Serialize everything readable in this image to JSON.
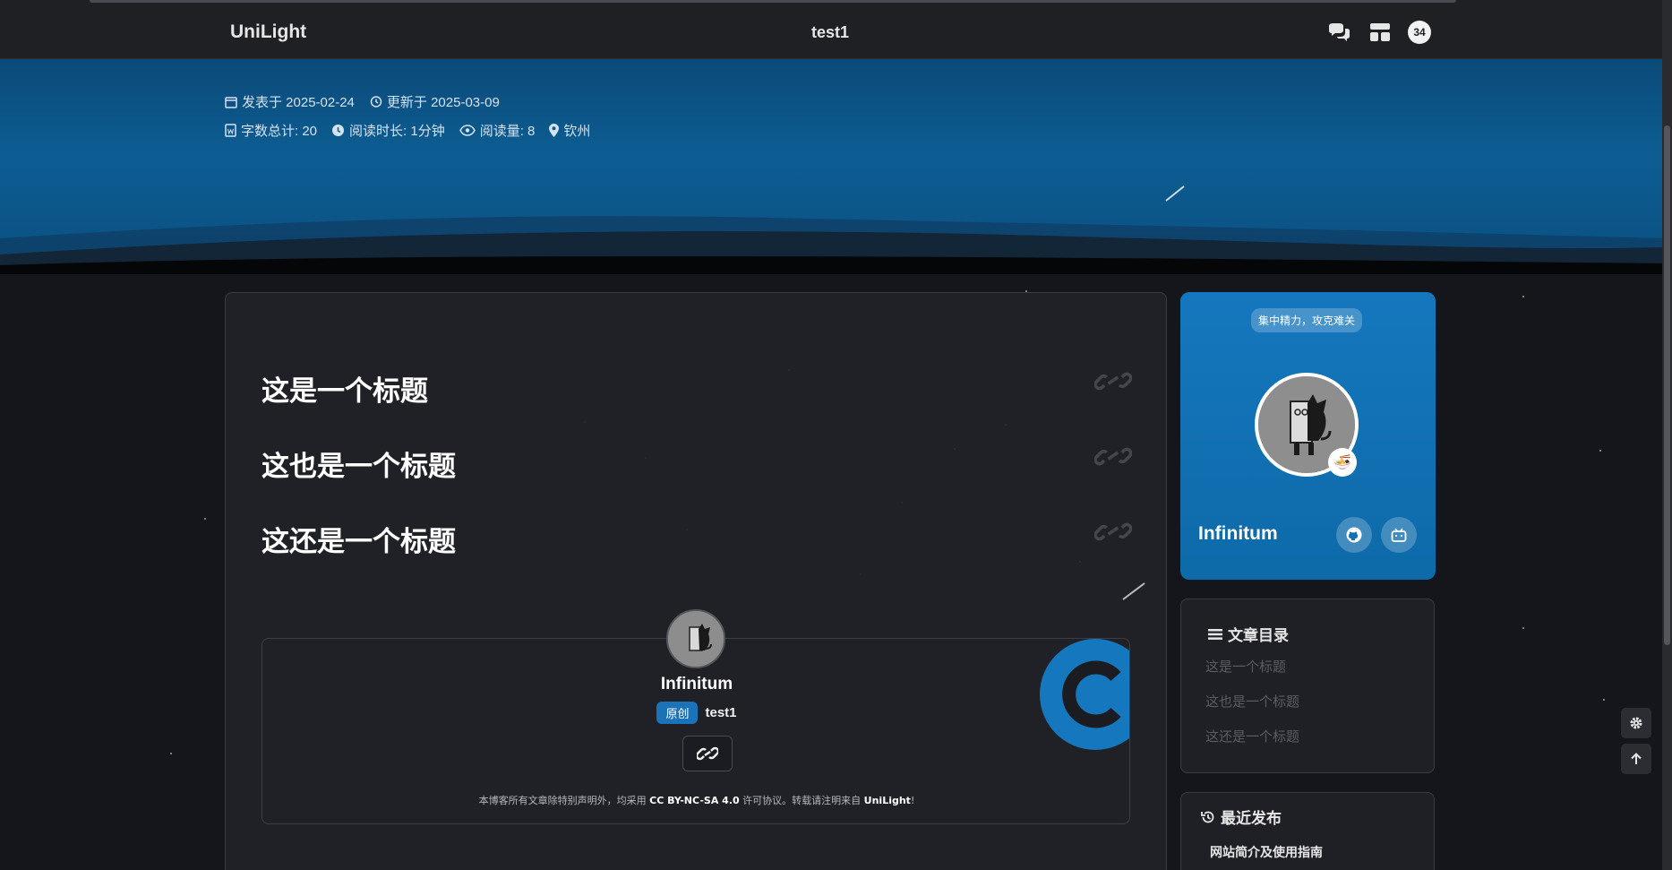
{
  "header": {
    "brand": "UniLight",
    "page_title": "test1",
    "notification_count": "34"
  },
  "meta": {
    "published": "发表于 2025-02-24",
    "updated": "更新于 2025-03-09",
    "word_count": "字数总计: 20",
    "read_time": "阅读时长: 1分钟",
    "views": "阅读量: 8",
    "location": "钦州"
  },
  "article": {
    "headings": [
      "这是一个标题",
      "这也是一个标题",
      "这还是一个标题"
    ]
  },
  "copyright": {
    "author": "Infinitum",
    "tag": "原创",
    "post_title": "test1",
    "license_prefix": "本博客所有文章除特别声明外，均采用 ",
    "license_name": "CC BY-NC-SA 4.0",
    "license_mid": " 许可协议。转载请注明来自 ",
    "license_site": "UniLight",
    "license_suffix": "!"
  },
  "profile": {
    "motto": "集中精力，攻克难关",
    "name": "Infinitum",
    "status_emoji": "🍜"
  },
  "toc": {
    "title": "文章目录",
    "items": [
      "这是一个标题",
      "这也是一个标题",
      "这还是一个标题"
    ]
  },
  "recent": {
    "title": "最近发布",
    "items": [
      "网站简介及使用指南"
    ]
  },
  "colors": {
    "accent": "#1577bd",
    "background": "#15161b",
    "card": "#222328"
  }
}
